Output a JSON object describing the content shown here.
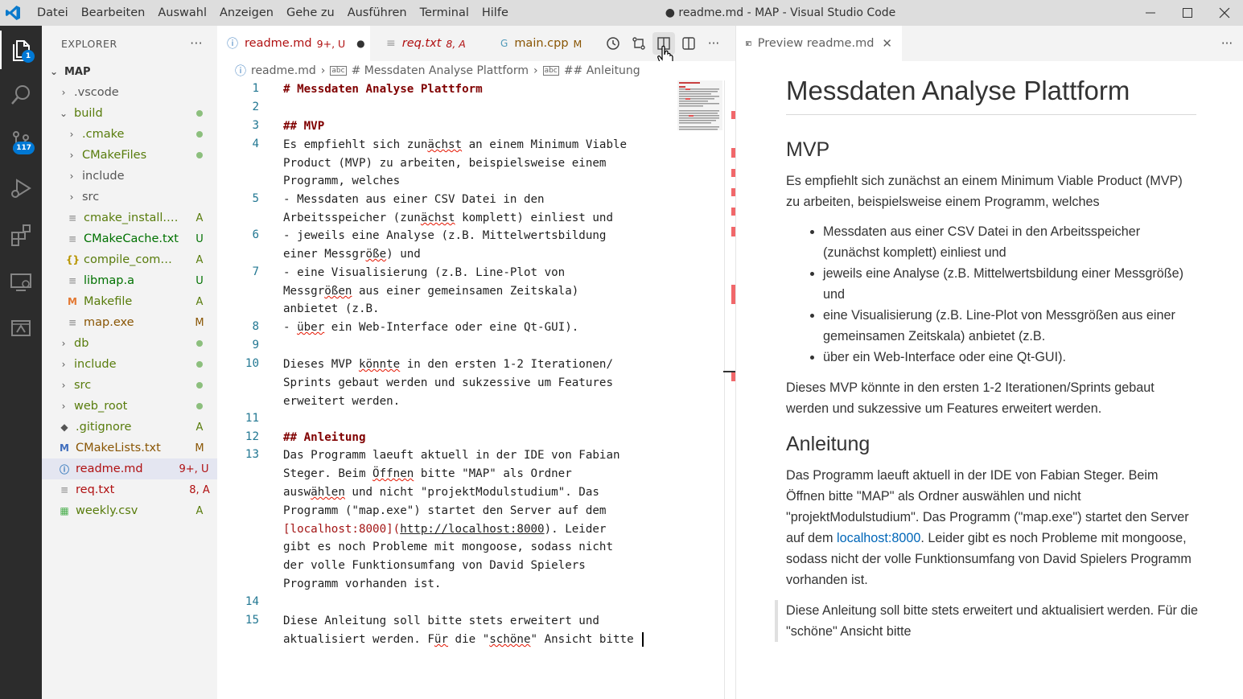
{
  "titlebar": {
    "menu": [
      "Datei",
      "Bearbeiten",
      "Auswahl",
      "Anzeigen",
      "Gehe zu",
      "Ausführen",
      "Terminal",
      "Hilfe"
    ],
    "title": "● readme.md - MAP - Visual Studio Code"
  },
  "activitybar": {
    "items": [
      "explorer-icon",
      "search-icon",
      "source-control-icon",
      "run-debug-icon",
      "extensions-icon",
      "remote-explorer-icon",
      "docker-icon"
    ],
    "explorer_badge": "1",
    "scm_badge": "117"
  },
  "sidebar": {
    "title": "EXPLORER",
    "more": "···",
    "root": "MAP",
    "items": [
      {
        "label": ".vscode",
        "deco": ""
      },
      {
        "label": "build",
        "deco": ""
      },
      {
        "label": ".cmake",
        "deco": ""
      },
      {
        "label": "CMakeFiles",
        "deco": ""
      },
      {
        "label": "include",
        "deco": ""
      },
      {
        "label": "src",
        "deco": ""
      },
      {
        "label": "cmake_install.cm...",
        "deco": "A"
      },
      {
        "label": "CMakeCache.txt",
        "deco": "U"
      },
      {
        "label": "compile_comman...",
        "deco": "A"
      },
      {
        "label": "libmap.a",
        "deco": "U"
      },
      {
        "label": "Makefile",
        "deco": "A"
      },
      {
        "label": "map.exe",
        "deco": "M"
      },
      {
        "label": "db",
        "deco": ""
      },
      {
        "label": "include",
        "deco": ""
      },
      {
        "label": "src",
        "deco": ""
      },
      {
        "label": "web_root",
        "deco": ""
      },
      {
        "label": ".gitignore",
        "deco": "A"
      },
      {
        "label": "CMakeLists.txt",
        "deco": "M"
      },
      {
        "label": "readme.md",
        "deco": "9+, U"
      },
      {
        "label": "req.txt",
        "deco": "8, A"
      },
      {
        "label": "weekly.csv",
        "deco": "A"
      }
    ]
  },
  "tabs": [
    {
      "label": "readme.md",
      "status": "9+, U"
    },
    {
      "label": "req.txt",
      "status": "8, A"
    },
    {
      "label": "main.cpp",
      "status": "M"
    }
  ],
  "breadcrumb": [
    "readme.md",
    "# Messdaten Analyse Plattform",
    "## Anleitung"
  ],
  "code": {
    "line_numbers": [
      "1",
      "2",
      "3",
      "4",
      "5",
      "6",
      "7",
      "8",
      "9",
      "10",
      "11",
      "12",
      "13",
      "14",
      "15"
    ],
    "l1": "# Messdaten Analyse Plattform",
    "l3": "## MVP",
    "l4a": "Es empfiehlt sich zun",
    "l4b": "ächst",
    "l4c": " an einem Minimum Viable",
    "l4d": "Product (MVP) zu arbeiten, beispielsweise einem",
    "l4e": "Programm, welches",
    "l5a": "- Messdaten aus einer CSV Datei in den",
    "l5b": "Arbeitsspeicher (zun",
    "l5c": "ächst",
    "l5d": " komplett) einliest und",
    "l6a": "- jeweils eine Analyse (z.B. Mittelwertsbildung",
    "l6b": "einer Messgr",
    "l6c": "öße",
    "l6d": ") und",
    "l7a": "- eine Visualisierung (z.B. Line-Plot von",
    "l7b": "Messgr",
    "l7c": "ößen",
    "l7d": " aus einer gemeinsamen Zeitskala)",
    "l7e": "anbietet (z.B.",
    "l8a": "- ",
    "l8b": "über",
    "l8c": " ein Web-Interface oder eine Qt-GUI).",
    "l10a": "Dieses MVP ",
    "l10b": "könnte",
    "l10c": " in den ersten 1-2 Iterationen/",
    "l10d": "Sprints gebaut werden und sukzessive um Features",
    "l10e": "erweitert werden.",
    "l12": "## Anleitung",
    "l13a": "Das Programm laeuft aktuell in der IDE von Fabian",
    "l13b": "Steger. Beim ",
    "l13c": "Öffnen",
    "l13d": " bitte \"MAP\" als Ordner",
    "l13e": "ausw",
    "l13f": "ählen",
    "l13g": " und nicht \"projektModulstudium\". Das",
    "l13h": "Programm (\"map.exe\") startet den Server auf dem",
    "l13i": "[localhost:8000](",
    "l13j": "http://localhost:8000",
    "l13k": "). Leider",
    "l13l": "gibt es noch Probleme mit mongoose, sodass nicht",
    "l13m": "der volle Funktionsumfang von David Spielers",
    "l13n": "Programm vorhanden ist.",
    "l15a": "Diese Anleitung soll bitte stets erweitert und",
    "l15b": "aktualisiert werden. F",
    "l15c": "ür",
    "l15d": " die \"",
    "l15e": "schöne",
    "l15f": "\" Ansicht bitte "
  },
  "preview": {
    "tab_label": "Preview readme.md",
    "h1": "Messdaten Analyse Plattform",
    "h2_mvp": "MVP",
    "p_mvp": "Es empfiehlt sich zunächst an einem Minimum Viable Product (MVP) zu arbeiten, beispielsweise einem Programm, welches",
    "list": [
      "Messdaten aus einer CSV Datei in den Arbeitsspeicher (zunächst komplett) einliest und",
      "jeweils eine Analyse (z.B. Mittelwertsbildung einer Messgröße) und",
      "eine Visualisierung (z.B. Line-Plot von Messgrößen aus einer gemeinsamen Zeitskala) anbietet (z.B.",
      "über ein Web-Interface oder eine Qt-GUI)."
    ],
    "p_sprints": "Dieses MVP könnte in den ersten 1-2 Iterationen/Sprints gebaut werden und sukzessive um Features erweitert werden.",
    "h2_anleitung": "Anleitung",
    "p_anl_1": "Das Programm laeuft aktuell in der IDE von Fabian Steger. Beim Öffnen bitte \"MAP\" als Ordner auswählen und nicht \"projektModulstudium\". Das Programm (\"map.exe\") startet den Server auf dem ",
    "link": "localhost:8000",
    "p_anl_2": ". Leider gibt es noch Probleme mit mongoose, sodass nicht der volle Funktionsumfang von David Spielers Programm vorhanden ist.",
    "blockquote": "Diese Anleitung soll bitte stets erweitert und aktualisiert werden. Für die \"schöne\" Ansicht bitte"
  },
  "colors": {
    "activitybar": "#2c2c2c",
    "accent": "#0078d4",
    "heading": "#800000",
    "git_added": "#587c0c",
    "git_modified": "#895503",
    "git_untracked": "#007100"
  }
}
